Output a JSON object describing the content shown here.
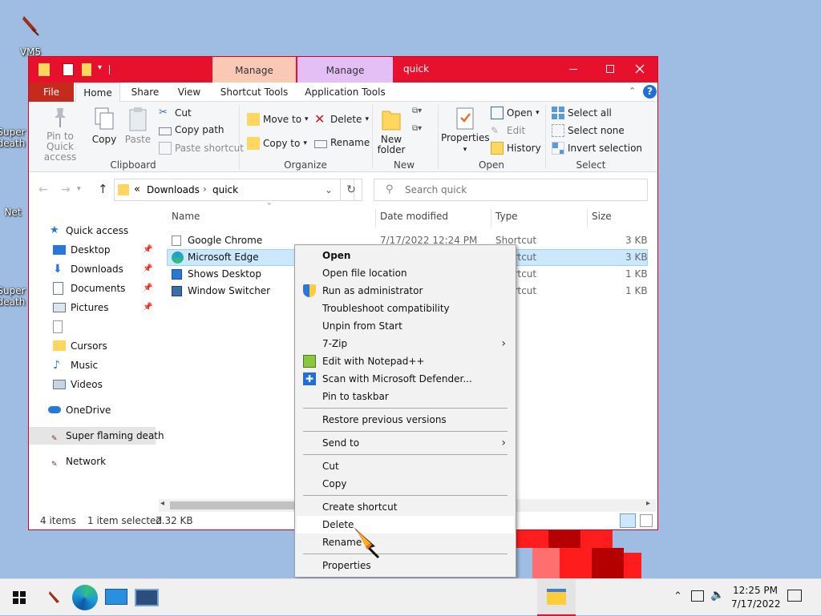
{
  "desktop": {
    "icons": [
      {
        "label": "VM5"
      },
      {
        "label": "Super death"
      },
      {
        "label": "Net"
      },
      {
        "label": "Super death"
      }
    ]
  },
  "window": {
    "title": "quick",
    "context_tabs": [
      {
        "label": "Manage",
        "color": "#f9c9b6"
      },
      {
        "label": "Manage",
        "color": "#e3bff5"
      }
    ],
    "ribbon_tabs": [
      "File",
      "Home",
      "Share",
      "View",
      "Shortcut Tools",
      "Application Tools"
    ],
    "ribbon": {
      "clipboard": {
        "pin": "Pin to Quick access",
        "copy": "Copy",
        "paste": "Paste",
        "cut": "Cut",
        "copy_path": "Copy path",
        "paste_shortcut": "Paste shortcut",
        "label": "Clipboard"
      },
      "organize": {
        "move_to": "Move to",
        "copy_to": "Copy to",
        "delete": "Delete",
        "rename": "Rename",
        "label": "Organize"
      },
      "new": {
        "new_folder": "New folder",
        "label": "New"
      },
      "open": {
        "properties": "Properties",
        "open": "Open",
        "edit": "Edit",
        "history": "History",
        "label": "Open"
      },
      "select": {
        "select_all": "Select all",
        "select_none": "Select none",
        "invert": "Invert selection",
        "label": "Select"
      }
    },
    "address": {
      "prefix": "«",
      "crumbs": [
        "Downloads",
        "quick"
      ]
    },
    "search": {
      "placeholder": "Search quick"
    },
    "nav": {
      "quick_access": "Quick access",
      "items": [
        {
          "label": "Desktop",
          "icon": "desktop-icon",
          "pinned": true
        },
        {
          "label": "Downloads",
          "icon": "download-icon",
          "pinned": true
        },
        {
          "label": "Documents",
          "icon": "documents-icon",
          "pinned": true
        },
        {
          "label": "Pictures",
          "icon": "pictures-icon",
          "pinned": true
        },
        {
          "label": "",
          "icon": "blank-file-icon",
          "pinned": false
        },
        {
          "label": "Cursors",
          "icon": "folder-icon",
          "pinned": false
        },
        {
          "label": "Music",
          "icon": "music-icon",
          "pinned": false
        },
        {
          "label": "Videos",
          "icon": "videos-icon",
          "pinned": false
        }
      ],
      "onedrive": "OneDrive",
      "user": "Super flaming death",
      "network": "Network"
    },
    "columns": [
      "Name",
      "Date modified",
      "Type",
      "Size"
    ],
    "files": [
      {
        "name": "Google Chrome",
        "date": "7/17/2022 12:24 PM",
        "type": "Shortcut",
        "size": "3 KB",
        "selected": false
      },
      {
        "name": "Microsoft Edge",
        "date": "",
        "type": "Shortcut",
        "size": "3 KB",
        "selected": true
      },
      {
        "name": "Shows Desktop",
        "date": "",
        "type": "Shortcut",
        "size": "1 KB",
        "selected": false
      },
      {
        "name": "Window Switcher",
        "date": "",
        "type": "Shortcut",
        "size": "1 KB",
        "selected": false
      }
    ],
    "status": {
      "count": "4 items",
      "selected": "1 item selected",
      "size": "2.32 KB"
    }
  },
  "context_menu": {
    "items": [
      {
        "label": "Open",
        "bold": true
      },
      {
        "label": "Open file location"
      },
      {
        "label": "Run as administrator",
        "icon": "shield-icon"
      },
      {
        "label": "Troubleshoot compatibility"
      },
      {
        "label": "Unpin from Start"
      },
      {
        "label": "7-Zip",
        "submenu": true
      },
      {
        "label": "Edit with Notepad++",
        "icon": "notepad-icon"
      },
      {
        "label": "Scan with Microsoft Defender...",
        "icon": "defender-icon"
      },
      {
        "label": "Pin to taskbar"
      },
      {
        "sep": true
      },
      {
        "label": "Restore previous versions"
      },
      {
        "sep": true
      },
      {
        "label": "Send to",
        "submenu": true
      },
      {
        "sep": true
      },
      {
        "label": "Cut"
      },
      {
        "label": "Copy"
      },
      {
        "sep": true
      },
      {
        "label": "Create shortcut"
      },
      {
        "label": "Delete",
        "highlight": true
      },
      {
        "label": "Rename"
      },
      {
        "sep": true
      },
      {
        "label": "Properties"
      }
    ]
  },
  "taskbar": {
    "time": "12:25 PM",
    "date": "7/17/2022"
  },
  "colors": {
    "accent": "#e8112d",
    "selection": "#cce8ff",
    "file_tab": "#c42b1c"
  }
}
